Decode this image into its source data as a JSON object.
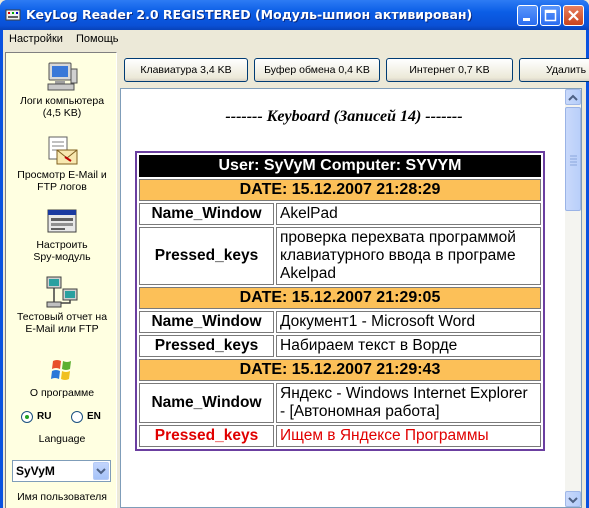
{
  "window": {
    "title": "KeyLog Reader 2.0  REGISTERED  (Модуль-шпион активирован)",
    "app_icon": "keylog-app-icon"
  },
  "menu": [
    "Настройки",
    "Помощь"
  ],
  "sidebar": {
    "items": [
      {
        "label1": "Логи компьютера",
        "label2": "(4,5 KB)",
        "icon": "computer-icon"
      },
      {
        "label1": "Просмотр E-Mail и",
        "label2": "FTP логов",
        "icon": "email-icon"
      },
      {
        "label1": "Настроить",
        "label2": "Spy-модуль",
        "icon": "settings-window-icon"
      },
      {
        "label1": "Тестовый отчет на",
        "label2": "E-Mail или FTP",
        "icon": "network-computers-icon"
      },
      {
        "label1": "О программе",
        "label2": "",
        "icon": "windows-logo-icon"
      }
    ],
    "language": {
      "ru": "RU",
      "en": "EN",
      "label": "Language",
      "selected": "RU"
    },
    "user_combo_value": "SyVyM",
    "user_label": "Имя пользователя"
  },
  "tabs": [
    "Клавиатура 3,4 KB",
    "Буфер обмена 0,4 KB",
    "Интернет 0,7 KB",
    "Удалить"
  ],
  "content": {
    "heading": "------- Keyboard (Записей 14) -------",
    "user_row": "User:  SyVyM  Computer:  SYVYM",
    "entries": [
      {
        "date": "DATE:  15.12.2007  21:28:29",
        "name_label": "Name_Window",
        "name_value": "AkelPad",
        "keys_label": "Pressed_keys",
        "keys_value": "проверка перехвата программой клавиатурного ввода в програме Akelpad"
      },
      {
        "date": "DATE:  15.12.2007  21:29:05",
        "name_label": "Name_Window",
        "name_value": "Документ1 - Microsoft Word",
        "keys_label": "Pressed_keys",
        "keys_value": "Набираем текст в Ворде"
      },
      {
        "date": "DATE:  15.12.2007  21:29:43",
        "name_label": "Name_Window",
        "name_value": "Яндекс - Windows Internet Explorer - [Автономная работа]",
        "keys_label": "Pressed_keys",
        "keys_value": "Ищем в Яндексе Программы"
      }
    ]
  },
  "colors": {
    "titlebar": "#0a5ae6",
    "date_row": "#fcc058",
    "table_border": "#6b3fa0",
    "highlight_red": "#e00000",
    "sidebar_bg": "#ffffe1"
  }
}
